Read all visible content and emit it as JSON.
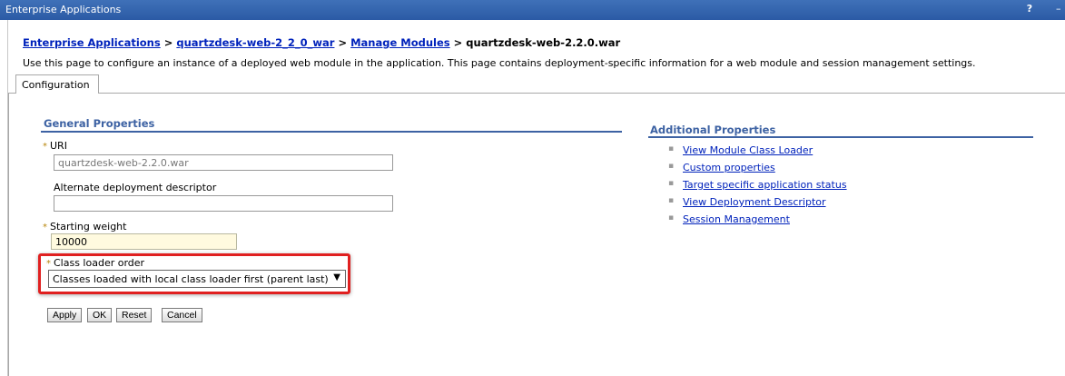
{
  "window": {
    "title": "Enterprise Applications",
    "help_label": "?",
    "minimize_label": "–"
  },
  "breadcrumb": {
    "item1": "Enterprise Applications",
    "sep1": " > ",
    "item2": "quartzdesk-web-2_2_0_war",
    "sep2": " > ",
    "item3": "Manage Modules",
    "sep3": " > ",
    "current": "quartzdesk-web-2.2.0.war"
  },
  "description": "Use this page to configure an instance of a deployed web module in the application. This page contains deployment-specific information for a web module and session management settings.",
  "tabs": [
    {
      "label": "Configuration"
    }
  ],
  "general_properties": {
    "heading": "General Properties",
    "required_marker": "*",
    "uri_label": "URI",
    "uri_value": "quartzdesk-web-2.2.0.war",
    "alt_dd_label": "Alternate deployment descriptor",
    "alt_dd_value": "",
    "starting_weight_label": "Starting weight",
    "starting_weight_value": "10000",
    "class_loader_label": "Class loader order",
    "class_loader_value": "Classes loaded with local class loader first (parent last)",
    "dropdown_arrow": "▼"
  },
  "buttons": {
    "apply": "Apply",
    "ok": "OK",
    "reset": "Reset",
    "cancel": "Cancel"
  },
  "additional_properties": {
    "heading": "Additional Properties",
    "bullet": "▪",
    "links": [
      "View Module Class Loader",
      "Custom properties",
      "Target specific application status",
      "View Deployment Descriptor",
      "Session Management"
    ]
  },
  "colors": {
    "titlebar": "#2f61ad",
    "section_heading": "#3d62a3",
    "link": "#0022bb",
    "highlight": "#e02020",
    "weight_field_bg": "#fffadf"
  }
}
